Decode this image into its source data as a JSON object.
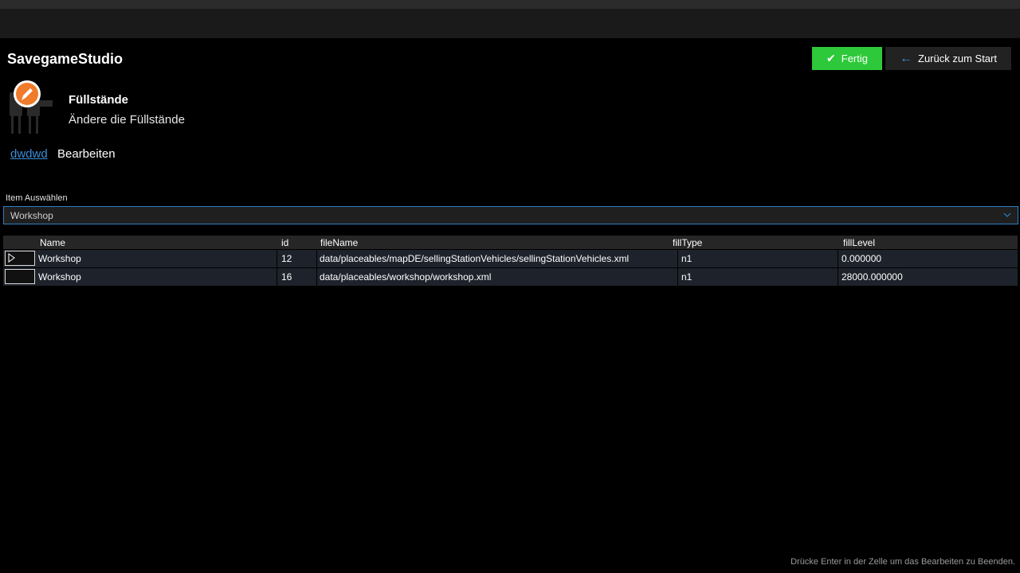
{
  "app": {
    "title": "SavegameStudio"
  },
  "actions": {
    "done_label": "Fertig",
    "back_label": "Zurück zum Start"
  },
  "section": {
    "title": "Füllstände",
    "description": "Ändere die Füllstände"
  },
  "breadcrumb": {
    "link": "dwdwd",
    "current": "Bearbeiten"
  },
  "item_select": {
    "label": "Item Auswählen",
    "selected": "Workshop"
  },
  "table": {
    "columns": [
      "Name",
      "id",
      "fileName",
      "fillType",
      "fillLevel"
    ],
    "rows": [
      {
        "name": "Workshop",
        "id": "12",
        "fileName": "data/placeables/mapDE/sellingStationVehicles/sellingStationVehicles.xml",
        "fillType": "n1",
        "fillLevel": "0.000000"
      },
      {
        "name": "Workshop",
        "id": "16",
        "fileName": "data/placeables/workshop/workshop.xml",
        "fillType": "n1",
        "fillLevel": "28000.000000"
      }
    ]
  },
  "status": {
    "hint": "Drücke Enter in der Zelle um das Bearbeiten zu Beenden."
  },
  "colors": {
    "accent_green": "#2ec93a",
    "accent_blue": "#2f7fc2",
    "icon_orange": "#f07b2b",
    "background": "#000000"
  },
  "icons": {
    "done": "checkmark-icon",
    "back": "arrow-left-icon",
    "plugin": "pencil-plug-icon",
    "select": "chevron-down-icon",
    "row_marker": "row-pointer-icon"
  }
}
